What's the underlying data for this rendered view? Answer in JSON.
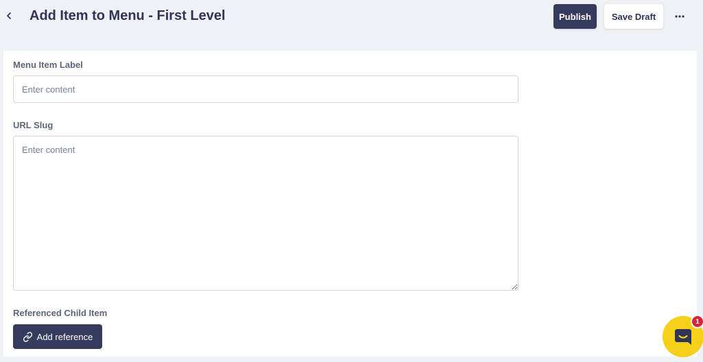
{
  "header": {
    "title": "Add Item to Menu - First Level",
    "publish_label": "Publish",
    "save_draft_label": "Save Draft"
  },
  "icons": {
    "back": "chevron-left-icon",
    "more": "more-horizontal-icon",
    "link": "link-icon",
    "chat": "chat-icon"
  },
  "form": {
    "menu_item_label": {
      "label": "Menu Item Label",
      "placeholder": "Enter content",
      "value": ""
    },
    "url_slug": {
      "label": "URL Slug",
      "placeholder": "Enter content",
      "value": ""
    },
    "referenced_child": {
      "label": "Referenced Child Item",
      "button_label": "Add reference"
    }
  },
  "chat": {
    "badge_count": "1"
  },
  "colors": {
    "primary": "#353b5c",
    "background": "#f0f1f6",
    "chat_launcher": "#f5cf18",
    "badge": "#d1283a"
  }
}
